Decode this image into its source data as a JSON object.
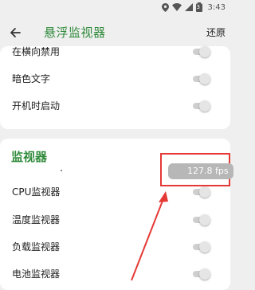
{
  "status_bar": {
    "time": "3:43",
    "icons": [
      "location-icon",
      "wifi-icon",
      "signal-icon",
      "battery-icon"
    ],
    "battery_level": "3"
  },
  "app_bar": {
    "title": "悬浮监视器",
    "action": "还原",
    "back_icon": "arrow-left-icon"
  },
  "settings_group_1": {
    "items": [
      {
        "label": "在横向禁用",
        "enabled": false
      },
      {
        "label": "暗色文字",
        "enabled": false
      },
      {
        "label": "开机时启动",
        "enabled": false
      }
    ]
  },
  "monitors_group": {
    "title": "监视器",
    "items": [
      {
        "label": "CPU监视器",
        "enabled": false
      },
      {
        "label": "温度监视器",
        "enabled": false
      },
      {
        "label": "负载监视器",
        "enabled": false
      },
      {
        "label": "电池监视器",
        "enabled": false
      }
    ]
  },
  "overlay": {
    "fps_text": "127.8 fps"
  },
  "colors": {
    "accent": "#2f8a3a",
    "highlight": "#e53935",
    "background": "#efefef"
  }
}
